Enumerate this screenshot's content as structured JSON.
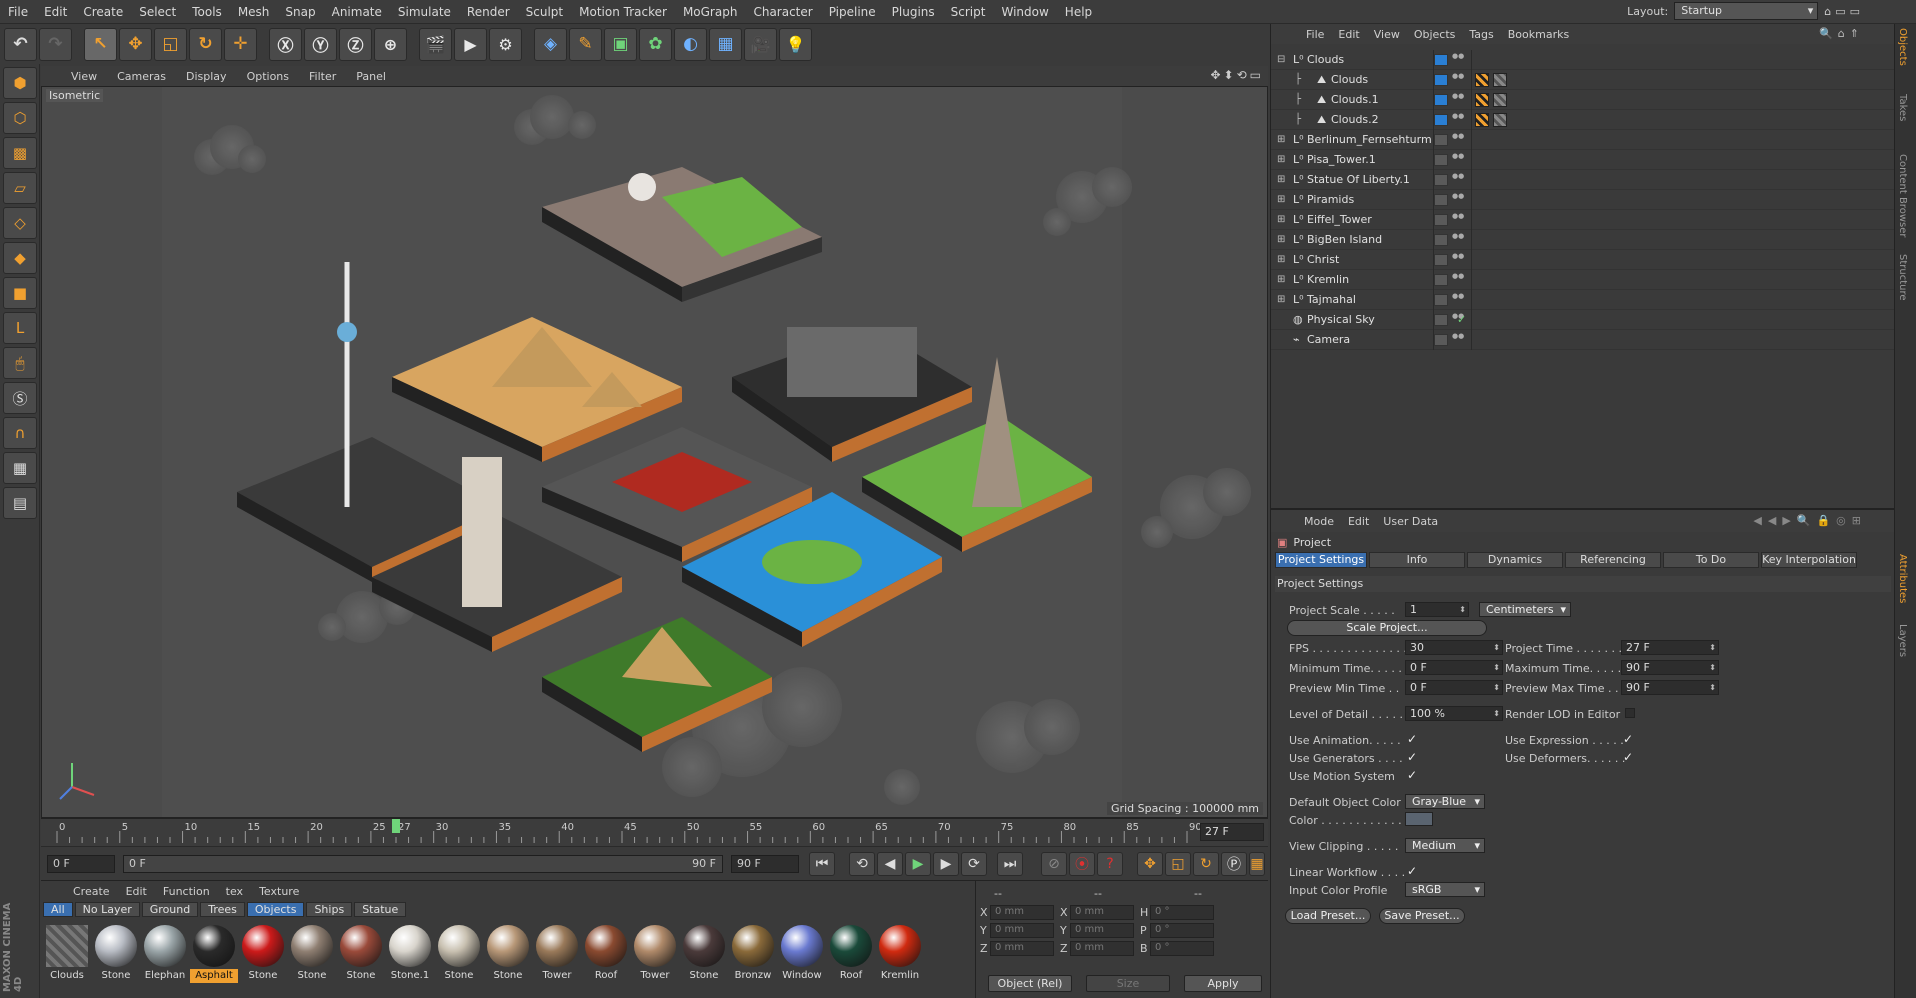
{
  "menubar": {
    "items": [
      "File",
      "Edit",
      "Create",
      "Select",
      "Tools",
      "Mesh",
      "Snap",
      "Animate",
      "Simulate",
      "Render",
      "Sculpt",
      "Motion Tracker",
      "MoGraph",
      "Character",
      "Pipeline",
      "Plugins",
      "Script",
      "Window",
      "Help"
    ],
    "layout_label": "Layout:",
    "layout_value": "Startup"
  },
  "viewport": {
    "menu": [
      "View",
      "Cameras",
      "Display",
      "Options",
      "Filter",
      "Panel"
    ],
    "label": "Isometric",
    "grid_spacing": "Grid Spacing : 100000 mm"
  },
  "timeline": {
    "ticks": [
      "0",
      "5",
      "10",
      "15",
      "20",
      "25",
      "27",
      "30",
      "35",
      "40",
      "45",
      "50",
      "55",
      "60",
      "65",
      "70",
      "75",
      "80",
      "85",
      "90"
    ],
    "current_frame": "27 F",
    "playhead_frame": 27,
    "max_frame": 90
  },
  "playback": {
    "start": "0 F",
    "range_start": "0 F",
    "range_end": "90 F",
    "end": "90 F"
  },
  "materials": {
    "menu": [
      "Create",
      "Edit",
      "Function",
      "tex",
      "Texture"
    ],
    "filters": [
      "All",
      "No Layer",
      "Ground",
      "Trees",
      "Objects",
      "Ships",
      "Statue"
    ],
    "active_filters": [
      "All",
      "Objects"
    ],
    "items": [
      {
        "label": "Clouds",
        "color": "#888888",
        "selected": false
      },
      {
        "label": "Stone",
        "color": "#b8bcc4",
        "selected": false
      },
      {
        "label": "Elephan",
        "color": "#9aa5a8",
        "selected": false
      },
      {
        "label": "Asphalt",
        "color": "#2a2a2a",
        "selected": true
      },
      {
        "label": "Stone",
        "color": "#cc1a1a",
        "selected": false
      },
      {
        "label": "Stone",
        "color": "#8f7f72",
        "selected": false
      },
      {
        "label": "Stone",
        "color": "#9a4a3a",
        "selected": false
      },
      {
        "label": "Stone.1",
        "color": "#d8d4cc",
        "selected": false
      },
      {
        "label": "Stone",
        "color": "#c8c0b0",
        "selected": false
      },
      {
        "label": "Stone",
        "color": "#b89878",
        "selected": false
      },
      {
        "label": "Tower",
        "color": "#9a7a5a",
        "selected": false
      },
      {
        "label": "Roof",
        "color": "#8a4a30",
        "selected": false
      },
      {
        "label": "Tower",
        "color": "#b08a6a",
        "selected": false
      },
      {
        "label": "Stone",
        "color": "#4a3a3a",
        "selected": false
      },
      {
        "label": "Bronzw",
        "color": "#8a6a3a",
        "selected": false
      },
      {
        "label": "Window",
        "color": "#6a7ad0",
        "selected": false
      },
      {
        "label": "Roof",
        "color": "#1a4a3a",
        "selected": false
      },
      {
        "label": "Kremlin",
        "color": "#d02a10",
        "selected": false
      }
    ]
  },
  "coords": {
    "headers": [
      "--",
      "--",
      "--"
    ],
    "rows": [
      [
        "X",
        "0 mm",
        "X",
        "0 mm",
        "H",
        "0 °"
      ],
      [
        "Y",
        "0 mm",
        "Y",
        "0 mm",
        "P",
        "0 °"
      ],
      [
        "Z",
        "0 mm",
        "Z",
        "0 mm",
        "B",
        "0 °"
      ]
    ],
    "mode": "Object (Rel)",
    "size": "Size",
    "apply": "Apply"
  },
  "objects": {
    "menu": [
      "File",
      "Edit",
      "View",
      "Objects",
      "Tags",
      "Bookmarks"
    ],
    "items": [
      {
        "name": "Clouds",
        "child": false,
        "expand": "⊟",
        "icon": "L⁰",
        "layer": "blue",
        "tags": []
      },
      {
        "name": "Clouds",
        "child": true,
        "expand": "",
        "icon": "⛰",
        "layer": "blue",
        "tags": [
          "chk",
          "tex"
        ]
      },
      {
        "name": "Clouds.1",
        "child": true,
        "expand": "",
        "icon": "⛰",
        "layer": "blue",
        "tags": [
          "chk",
          "tex"
        ]
      },
      {
        "name": "Clouds.2",
        "child": true,
        "expand": "",
        "icon": "⛰",
        "layer": "blue",
        "tags": [
          "chk",
          "tex"
        ]
      },
      {
        "name": "Berlinum_Fernsehturm",
        "child": false,
        "expand": "⊞",
        "icon": "L⁰",
        "layer": "grey",
        "tags": []
      },
      {
        "name": "Pisa_Tower.1",
        "child": false,
        "expand": "⊞",
        "icon": "L⁰",
        "layer": "grey",
        "tags": []
      },
      {
        "name": "Statue Of Liberty.1",
        "child": false,
        "expand": "⊞",
        "icon": "L⁰",
        "layer": "grey",
        "tags": []
      },
      {
        "name": "Piramids",
        "child": false,
        "expand": "⊞",
        "icon": "L⁰",
        "layer": "grey",
        "tags": []
      },
      {
        "name": "Eiffel_Tower",
        "child": false,
        "expand": "⊞",
        "icon": "L⁰",
        "layer": "grey",
        "tags": []
      },
      {
        "name": "BigBen Island",
        "child": false,
        "expand": "⊞",
        "icon": "L⁰",
        "layer": "grey",
        "tags": []
      },
      {
        "name": "Christ",
        "child": false,
        "expand": "⊞",
        "icon": "L⁰",
        "layer": "grey",
        "tags": []
      },
      {
        "name": "Kremlin",
        "child": false,
        "expand": "⊞",
        "icon": "L⁰",
        "layer": "grey",
        "tags": []
      },
      {
        "name": "Tajmahal",
        "child": false,
        "expand": "⊞",
        "icon": "L⁰",
        "layer": "grey",
        "tags": []
      },
      {
        "name": "Physical Sky",
        "child": false,
        "expand": "",
        "icon": "◍",
        "layer": "grey",
        "tags": [],
        "check": true
      },
      {
        "name": "Camera",
        "child": false,
        "expand": "",
        "icon": "⌁",
        "layer": "grey",
        "tags": []
      }
    ]
  },
  "attributes": {
    "menu": [
      "Mode",
      "Edit",
      "User Data"
    ],
    "title": "Project",
    "tabs": [
      "Project Settings",
      "Info",
      "Dynamics",
      "Referencing",
      "To Do",
      "Key Interpolation"
    ],
    "section": "Project Settings",
    "project_scale_label": "Project Scale . . . . .",
    "project_scale": "1",
    "scale_unit": "Centimeters",
    "scale_project_btn": "Scale Project...",
    "fps_label": "FPS . . . . . . . . . . . . . .",
    "fps": "30",
    "project_time_label": "Project Time . . . . . . . .",
    "project_time": "27 F",
    "min_time_label": "Minimum Time. . . . .",
    "min_time": "0 F",
    "max_time_label": "Maximum Time. . . . . . .",
    "max_time": "90 F",
    "prev_min_label": "Preview Min Time . .",
    "prev_min": "0 F",
    "prev_max_label": "Preview Max Time . . . .",
    "prev_max": "90 F",
    "lod_label": "Level of Detail . . . . .",
    "lod": "100 %",
    "render_lod_label": "Render LOD in Editor",
    "use_anim_label": "Use Animation. . . . .",
    "use_expr_label": "Use Expression . . . . .",
    "use_gen_label": "Use Generators . . . .",
    "use_def_label": "Use Deformers. . . . . .",
    "use_motion_label": "Use Motion System",
    "default_color_label": "Default Object Color",
    "default_color": "Gray-Blue",
    "color_label": "Color . . . . . . . . . . . .",
    "view_clip_label": "View Clipping . . . . .",
    "view_clip": "Medium",
    "linear_wf_label": "Linear Workflow . . . .",
    "input_profile_label": "Input Color Profile",
    "input_profile": "sRGB",
    "load_preset": "Load Preset...",
    "save_preset": "Save Preset..."
  },
  "sidetabs": [
    "Objects",
    "Takes",
    "Content Browser",
    "Structure",
    "Attributes",
    "Layers"
  ],
  "logo": "MAXON CINEMA 4D"
}
